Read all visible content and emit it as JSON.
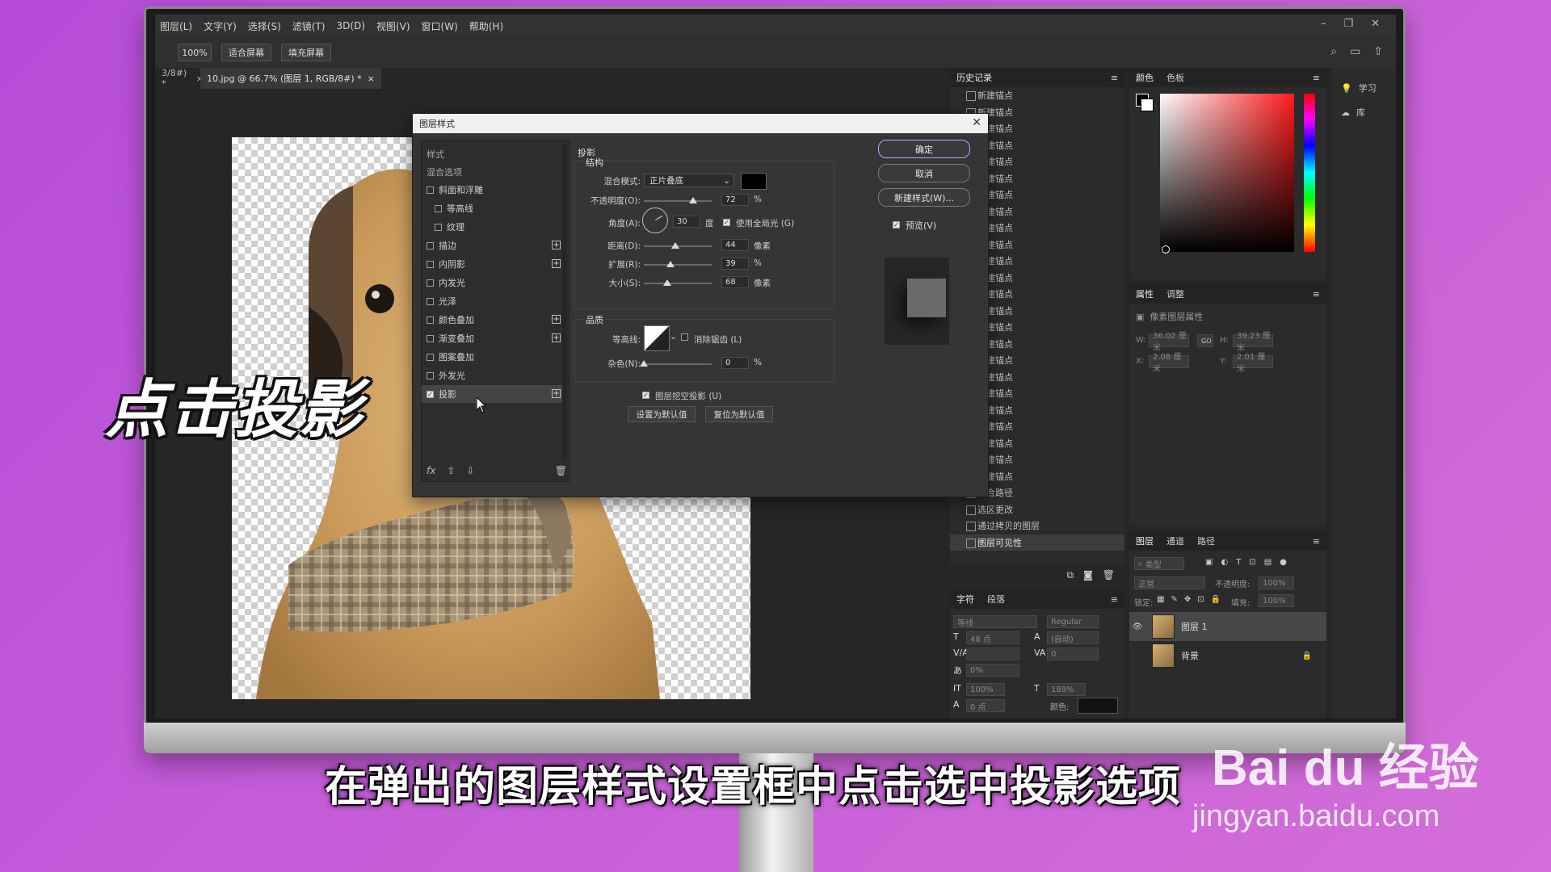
{
  "menu": [
    "图层(L)",
    "文字(Y)",
    "选择(S)",
    "滤镜(T)",
    "3D(D)",
    "视图(V)",
    "窗口(W)",
    "帮助(H)"
  ],
  "options_bar": {
    "zoom": "100%",
    "fit_screen": "适合屏幕",
    "fill_screen": "填充屏幕"
  },
  "tabs": [
    {
      "label": "3/8#) *",
      "close": "×"
    },
    {
      "label": "10.jpg @ 66.7% (图层 1, RGB/8#) *",
      "close": "×"
    }
  ],
  "dialog": {
    "title": "图层样式",
    "close": "✕",
    "styles_header": "样式",
    "blend_options": "混合选项",
    "style_items": [
      {
        "label": "斜面和浮雕",
        "checked": false,
        "indent": false,
        "plus": false
      },
      {
        "label": "等高线",
        "checked": false,
        "indent": true,
        "plus": false
      },
      {
        "label": "纹理",
        "checked": false,
        "indent": true,
        "plus": false
      },
      {
        "label": "描边",
        "checked": false,
        "indent": false,
        "plus": true
      },
      {
        "label": "内阴影",
        "checked": false,
        "indent": false,
        "plus": true
      },
      {
        "label": "内发光",
        "checked": false,
        "indent": false,
        "plus": false
      },
      {
        "label": "光泽",
        "checked": false,
        "indent": false,
        "plus": false
      },
      {
        "label": "颜色叠加",
        "checked": false,
        "indent": false,
        "plus": true
      },
      {
        "label": "渐变叠加",
        "checked": false,
        "indent": false,
        "plus": true
      },
      {
        "label": "图案叠加",
        "checked": false,
        "indent": false,
        "plus": false
      },
      {
        "label": "外发光",
        "checked": false,
        "indent": false,
        "plus": false
      },
      {
        "label": "投影",
        "checked": true,
        "indent": false,
        "plus": true,
        "selected": true
      }
    ],
    "footer_fx": "fx",
    "section": "投影",
    "structure": "结构",
    "blend_mode_label": "混合模式:",
    "blend_mode_value": "正片叠底",
    "opacity_label": "不透明度(O):",
    "opacity_value": "72",
    "percent": "%",
    "angle_label": "角度(A):",
    "angle_value": "30",
    "degree": "度",
    "global_light": "使用全局光 (G)",
    "distance_label": "距离(D):",
    "distance_value": "44",
    "pixels": "像素",
    "spread_label": "扩展(R):",
    "spread_value": "39",
    "size_label": "大小(S):",
    "size_value": "68",
    "quality": "品质",
    "contour_label": "等高线:",
    "anti_alias": "消除锯齿 (L)",
    "noise_label": "杂色(N):",
    "noise_value": "0",
    "knockout": "图层挖空投影 (U)",
    "make_default": "设置为默认值",
    "reset_default": "复位为默认值",
    "ok": "确定",
    "cancel": "取消",
    "new_style": "新建样式(W)...",
    "preview": "预览(V)",
    "shadow_color": "#000000"
  },
  "history": {
    "tab": "历史记录",
    "anchor_label": "新建锚点",
    "anchor_count": 24,
    "extra_items": [
      "闭合路径",
      "选区更改",
      "通过拷贝的图层",
      "图层可见性"
    ]
  },
  "character": {
    "tabs": [
      "字符",
      "段落"
    ],
    "font_family": "等线",
    "font_style": "Regular",
    "font_size": "48 点",
    "leading": "(自动)",
    "tracking": "0",
    "scale_pct": "0%",
    "v_scale": "100%",
    "h_scale": "189%",
    "baseline": "0 点",
    "color_label": "颜色:"
  },
  "color_panel": {
    "tabs": [
      "颜色",
      "色板"
    ],
    "hue": "#ff1a1a"
  },
  "properties": {
    "tabs": [
      "属性",
      "调整"
    ],
    "subtitle": "像素图层属性",
    "w_label": "W:",
    "w": "36.02 厘米",
    "link": "GO",
    "h_label": "H:",
    "h": "39.23 厘米",
    "x_label": "X:",
    "x": "2.08 厘米",
    "y_label": "Y:",
    "y": "2.01 厘米"
  },
  "layers": {
    "tabs": [
      "图层",
      "通道",
      "路径"
    ],
    "filter": "类型",
    "blend": "正常",
    "opacity_label": "不透明度:",
    "opacity": "100%",
    "lock_label": "锁定:",
    "fill_label": "填充:",
    "fill": "100%",
    "items": [
      {
        "name": "图层 1",
        "selected": true
      },
      {
        "name": "背景",
        "selected": false
      }
    ]
  },
  "dock": [
    {
      "label": "学习"
    },
    {
      "label": "库"
    }
  ],
  "overlay": {
    "title": "点击投影",
    "subtitle": "在弹出的图层样式设置框中点击选中投影选项"
  },
  "watermark": {
    "logo": "Bai du 经验",
    "url": "jingyan.baidu.com"
  }
}
